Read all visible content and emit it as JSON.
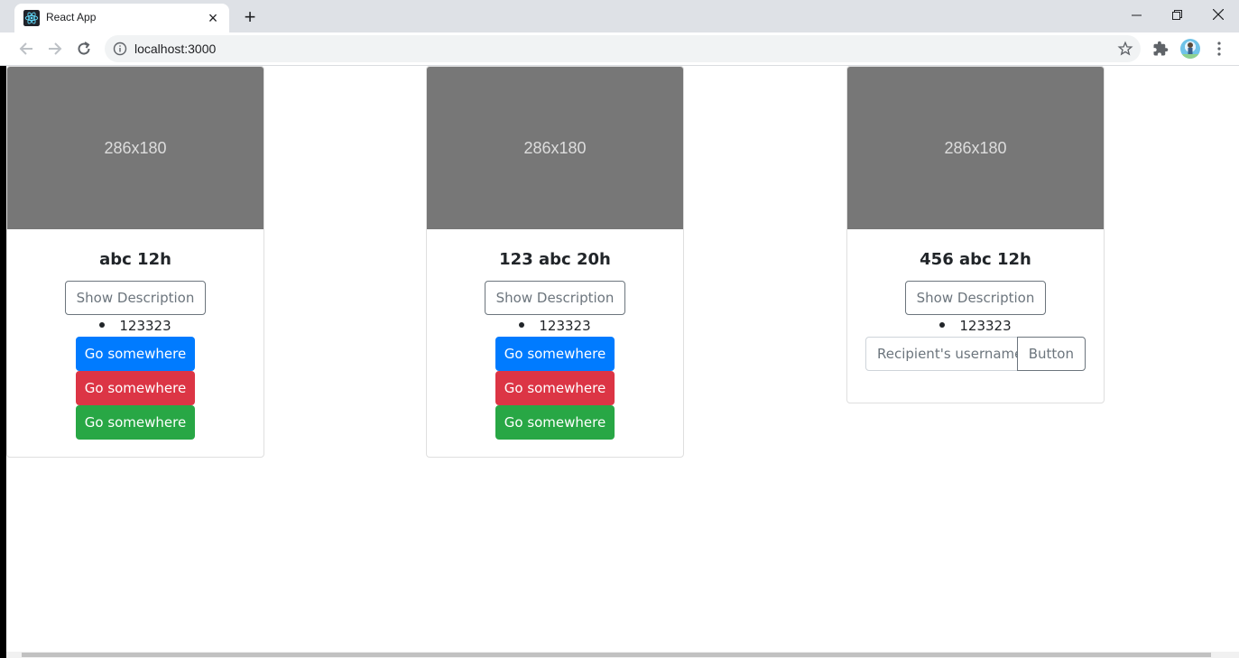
{
  "browser": {
    "tab_title": "React App",
    "url": "localhost:3000"
  },
  "colors": {
    "primary": "#007bff",
    "danger": "#dc3545",
    "success": "#28a745",
    "secondary": "#6c757d",
    "placeholder_bg": "#777777"
  },
  "cards": [
    {
      "image_label": "286x180",
      "title": "abc 12h",
      "show_description": "Show Description",
      "description_items": [
        "123323"
      ],
      "buttons": [
        {
          "label": "Go somewhere",
          "variant": "primary"
        },
        {
          "label": "Go somewhere",
          "variant": "danger"
        },
        {
          "label": "Go somewhere",
          "variant": "success"
        }
      ]
    },
    {
      "image_label": "286x180",
      "title": "123 abc 20h",
      "show_description": "Show Description",
      "description_items": [
        "123323"
      ],
      "buttons": [
        {
          "label": "Go somewhere",
          "variant": "primary"
        },
        {
          "label": "Go somewhere",
          "variant": "danger"
        },
        {
          "label": "Go somewhere",
          "variant": "success"
        }
      ]
    },
    {
      "image_label": "286x180",
      "title": "456 abc 12h",
      "show_description": "Show Description",
      "description_items": [
        "123323"
      ],
      "input_placeholder": "Recipient's username",
      "input_button": "Button"
    }
  ]
}
